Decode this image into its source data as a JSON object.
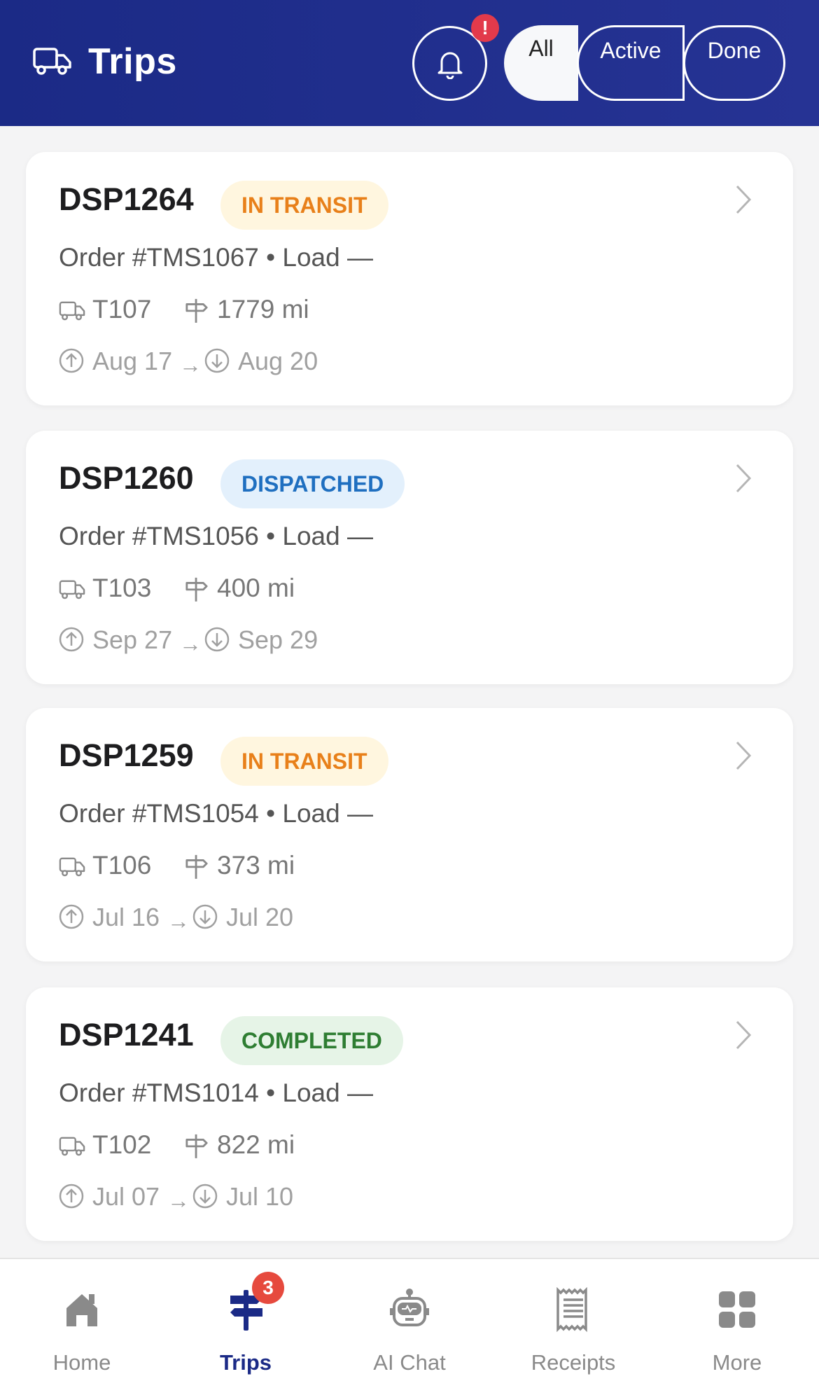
{
  "header": {
    "title": "Trips",
    "notification_badge": "!",
    "filters": [
      {
        "label": "All",
        "selected": true
      },
      {
        "label": "Active",
        "selected": false
      },
      {
        "label": "Done",
        "selected": false
      }
    ]
  },
  "trips": [
    {
      "id": "DSP1264",
      "status": "IN TRANSIT",
      "status_color": "#e8801a",
      "status_bg": "#fff6df",
      "order": "Order #TMS1067 • Load —",
      "truck": "T107",
      "distance": "1779 mi",
      "pickup": "Aug 17",
      "arrow": "→",
      "delivery": "Aug 20"
    },
    {
      "id": "DSP1260",
      "status": "DISPATCHED",
      "status_color": "#1f6fc0",
      "status_bg": "#e3f0fc",
      "order": "Order #TMS1056 • Load —",
      "truck": "T103",
      "distance": "400 mi",
      "pickup": "Sep 27",
      "arrow": "→",
      "delivery": "Sep 29"
    },
    {
      "id": "DSP1259",
      "status": "IN TRANSIT",
      "status_color": "#e8801a",
      "status_bg": "#fff6df",
      "order": "Order #TMS1054 • Load —",
      "truck": "T106",
      "distance": "373 mi",
      "pickup": "Jul 16",
      "arrow": "→",
      "delivery": "Jul 20"
    },
    {
      "id": "DSP1241",
      "status": "COMPLETED",
      "status_color": "#2e7d32",
      "status_bg": "#e6f4e7",
      "order": "Order #TMS1014 • Load —",
      "truck": "T102",
      "distance": "822 mi",
      "pickup": "Jul 07",
      "arrow": "→",
      "delivery": "Jul 10"
    }
  ],
  "nav": {
    "items": [
      {
        "label": "Home",
        "icon": "home-icon"
      },
      {
        "label": "Trips",
        "icon": "signpost-icon",
        "active": true,
        "badge": "3"
      },
      {
        "label": "AI Chat",
        "icon": "robot-icon"
      },
      {
        "label": "Receipts",
        "icon": "receipt-icon"
      },
      {
        "label": "More",
        "icon": "grid-icon"
      }
    ]
  },
  "colors": {
    "header": "#1b2a86",
    "nav_active": "#1b2a86",
    "badge": "#e64a3e"
  }
}
